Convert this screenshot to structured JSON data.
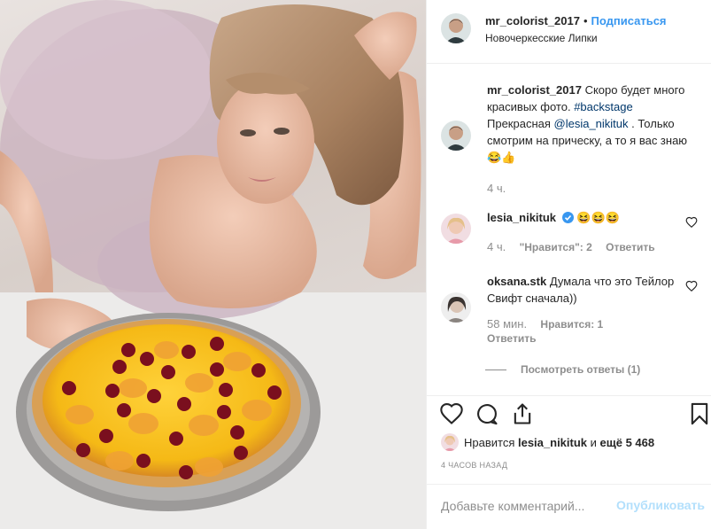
{
  "post": {
    "username": "mr_colorist_2017",
    "dot": "•",
    "follow_label": "Подписаться",
    "location": "Новочеркесские Липки"
  },
  "caption": {
    "username": "mr_colorist_2017",
    "text_before": " Скоро будет много красивых фото. ",
    "hashtag": "#backstage",
    "text_mid": " Прекрасная ",
    "mention": "@lesia_nikituk",
    "text_after": " . Только смотрим на прическу, а то я вас знаю",
    "emoji": "😂👍",
    "time": "4 ч."
  },
  "comments": [
    {
      "username": "lesia_nikituk",
      "verified_icon": "verified-badge-icon",
      "text": " 😆😆😆",
      "time": "4 ч.",
      "likes": "\"Нравится\": 2",
      "reply": "Ответить"
    },
    {
      "username": "oksana.stk",
      "text": " Думала что это Тейлор Свифт сначала))",
      "time": "58 мин.",
      "likes": "Нравится: 1",
      "reply": "Ответить"
    }
  ],
  "view_replies": "Посмотреть ответы (1)",
  "likes_line": {
    "prefix": "Нравится ",
    "user": "lesia_nikituk",
    "mid": " и ",
    "count": "ещё 5 468"
  },
  "timestamp": "4 ЧАСОВ НАЗАД",
  "add_comment": {
    "placeholder": "Добавьте комментарий...",
    "button": "Опубликовать"
  },
  "icons": {
    "like": "heart-icon",
    "comment": "comment-icon",
    "share": "share-icon",
    "save": "bookmark-icon"
  },
  "colors": {
    "accent": "#3897f0",
    "link": "#00376b",
    "muted": "#8e8e8e",
    "publish_disabled": "#b2dffc"
  }
}
